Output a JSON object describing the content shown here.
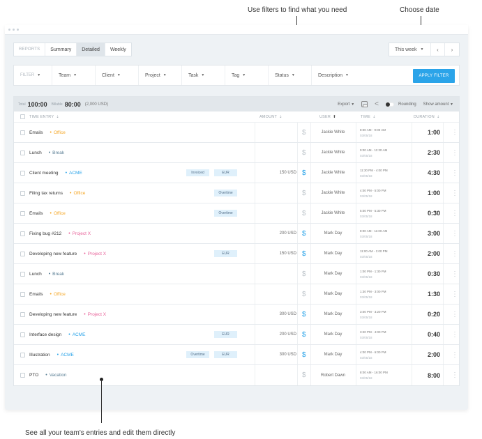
{
  "annotations": {
    "filters": "Use filters to find what you need",
    "date": "Choose date",
    "entries": "See all your team's entries and edit them directly"
  },
  "window": {
    "tabs": [
      {
        "label": "REPORTS",
        "state": "muted"
      },
      {
        "label": "Summary",
        "state": "normal"
      },
      {
        "label": "Detailed",
        "state": "active"
      },
      {
        "label": "Weekly",
        "state": "normal"
      }
    ],
    "date_range": {
      "label": "This week",
      "prev_icon": "chevron-left",
      "next_icon": "chevron-right"
    }
  },
  "filters": {
    "items": [
      {
        "label": "FILTER"
      },
      {
        "label": "Team"
      },
      {
        "label": "Client"
      },
      {
        "label": "Project"
      },
      {
        "label": "Task"
      },
      {
        "label": "Tag"
      },
      {
        "label": "Status"
      },
      {
        "label": "Description"
      }
    ],
    "apply_label": "APPLY FILTER",
    "accent": "#2ba4e9"
  },
  "summary": {
    "total_label": "Total",
    "total_value": "100:00",
    "billable_label": "Billable",
    "billable_value": "80:00",
    "billable_amount": "(2,000 USD)",
    "export_label": "Export",
    "rounding_label": "Rounding",
    "show_amount_label": "Show amount"
  },
  "columns": {
    "entry": "TIME ENTRY",
    "amount": "AMOUNT",
    "user": "USER",
    "time": "TIME",
    "duration": "DURATION"
  },
  "rows": [
    {
      "desc": "Emails",
      "project": "Office",
      "color": "#f5a623",
      "tags": [],
      "amount": "",
      "billable": false,
      "user": "Jackie White",
      "time": "8:00 AM - 9:00 AM",
      "date": "03/05/18",
      "duration": "1:00"
    },
    {
      "desc": "Lunch",
      "project": "Break",
      "color": "#5b7f95",
      "tags": [],
      "amount": "",
      "billable": false,
      "user": "Jackie White",
      "time": "9:00 AM - 11:30 AM",
      "date": "03/05/18",
      "duration": "2:30"
    },
    {
      "desc": "Client meeting",
      "project": "ACME",
      "color": "#2ba4e9",
      "tags": [
        "Invoiced",
        "EUR"
      ],
      "amount": "150 USD",
      "billable": true,
      "user": "Jackie White",
      "time": "11:30 PM - 4:00 PM",
      "date": "03/05/18",
      "duration": "4:30"
    },
    {
      "desc": "Filing tax returns",
      "project": "Office",
      "color": "#f5a623",
      "tags": [
        "Overtime"
      ],
      "amount": "",
      "billable": false,
      "user": "Jackie White",
      "time": "4:00 PM - 5:00 PM",
      "date": "03/05/18",
      "duration": "1:00"
    },
    {
      "desc": "Emails",
      "project": "Office",
      "color": "#f5a623",
      "tags": [
        "Overtime"
      ],
      "amount": "",
      "billable": false,
      "user": "Jackie White",
      "time": "5:00 PM - 5:30 PM",
      "date": "03/05/18",
      "duration": "0:30"
    },
    {
      "desc": "Fixing bug #212",
      "project": "Project X",
      "color": "#e8639a",
      "tags": [],
      "amount": "200 USD",
      "billable": true,
      "user": "Mark Day",
      "time": "8:00 AM - 11:00 AM",
      "date": "03/05/18",
      "duration": "3:00"
    },
    {
      "desc": "Developing new feature",
      "project": "Project X",
      "color": "#e8639a",
      "tags": [
        "EUR"
      ],
      "amount": "150 USD",
      "billable": true,
      "user": "Mark Day",
      "time": "11:00 AM - 1:00 PM",
      "date": "03/05/18",
      "duration": "2:00"
    },
    {
      "desc": "Lunch",
      "project": "Break",
      "color": "#5b7f95",
      "tags": [],
      "amount": "",
      "billable": false,
      "user": "Mark Day",
      "time": "1:00 PM - 1:30 PM",
      "date": "03/05/18",
      "duration": "0:30"
    },
    {
      "desc": "Emails",
      "project": "Office",
      "color": "#f5a623",
      "tags": [],
      "amount": "",
      "billable": false,
      "user": "Mark Day",
      "time": "1:30 PM - 3:00 PM",
      "date": "03/05/18",
      "duration": "1:30"
    },
    {
      "desc": "Developing new feature",
      "project": "Project X",
      "color": "#e8639a",
      "tags": [],
      "amount": "300 USD",
      "billable": true,
      "user": "Mark Day",
      "time": "3:00 PM - 3:20 PM",
      "date": "03/05/18",
      "duration": "0:20"
    },
    {
      "desc": "Interface design",
      "project": "ACME",
      "color": "#2ba4e9",
      "tags": [
        "EUR"
      ],
      "amount": "200 USD",
      "billable": true,
      "user": "Mark Day",
      "time": "3:20 PM - 4:00 PM",
      "date": "03/05/18",
      "duration": "0:40"
    },
    {
      "desc": "Illustration",
      "project": "ACME",
      "color": "#2ba4e9",
      "tags": [
        "Overtime",
        "EUR"
      ],
      "amount": "300 USD",
      "billable": true,
      "user": "Mark Day",
      "time": "4:00 PM - 6:00 PM",
      "date": "03/05/18",
      "duration": "2:00"
    },
    {
      "desc": "PTO",
      "project": "Vacation",
      "color": "#5b7f95",
      "tags": [],
      "amount": "",
      "billable": false,
      "user": "Robert Dawn",
      "time": "8:00 AM - 16:00 PM",
      "date": "03/05/18",
      "duration": "8:00"
    }
  ]
}
